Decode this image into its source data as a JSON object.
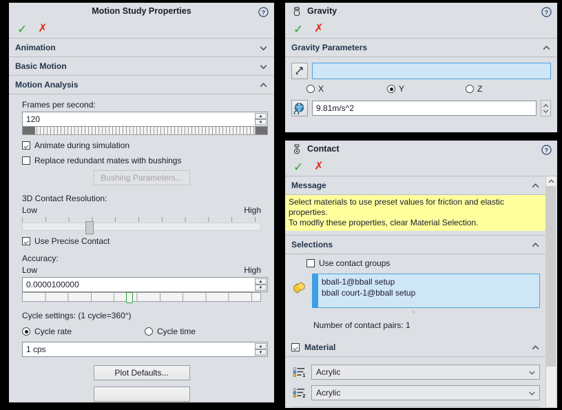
{
  "motion_study": {
    "title": "Motion Study Properties",
    "help_icon": "help-circle-icon",
    "accept_icon": "check-icon",
    "cancel_icon": "x-icon",
    "groups": [
      {
        "label": "Animation",
        "expanded": false
      },
      {
        "label": "Basic Motion",
        "expanded": false
      },
      {
        "label": "Motion Analysis",
        "expanded": true
      }
    ],
    "frames_per_second": {
      "label": "Frames per second:",
      "value": "120"
    },
    "animate_during_simulation": {
      "label": "Animate during simulation",
      "checked": true
    },
    "replace_redundant_mates": {
      "label": "Replace redundant mates with bushings",
      "checked": false
    },
    "bushing_parameters_button": {
      "label": "Bushing Parameters...",
      "enabled": false
    },
    "contact_resolution": {
      "label": "3D Contact Resolution:",
      "low_label": "Low",
      "high_label": "High",
      "position_percent": 28
    },
    "use_precise_contact": {
      "label": "Use Precise Contact",
      "checked": true
    },
    "accuracy": {
      "label": "Accuracy:",
      "low_label": "Low",
      "high_label": "High",
      "value": "0.0000100000",
      "position_percent": 45
    },
    "cycle_settings": {
      "label": "Cycle settings: (1 cycle=360°)",
      "cycle_rate_label": "Cycle rate",
      "cycle_time_label": "Cycle time",
      "selected": "Cycle rate",
      "rate_value": "1 cps"
    },
    "plot_defaults_button": "Plot Defaults..."
  },
  "gravity": {
    "title": "Gravity",
    "title_icon": "gravity-icon",
    "help_icon": "help-circle-icon",
    "accept_icon": "check-icon",
    "cancel_icon": "x-icon",
    "parameters_group": {
      "label": "Gravity Parameters",
      "expanded": true
    },
    "reference_selection": {
      "icon": "select-direction-icon",
      "value": ""
    },
    "axis_options": [
      {
        "label": "X",
        "selected": false
      },
      {
        "label": "Y",
        "selected": true
      },
      {
        "label": "Z",
        "selected": false
      }
    ],
    "magnitude": {
      "icon": "numeric-globe-icon",
      "value": "9.81m/s^2"
    }
  },
  "contact": {
    "title": "Contact",
    "title_icon": "contact-icon",
    "help_icon": "help-circle-icon",
    "accept_icon": "check-icon",
    "cancel_icon": "x-icon",
    "message_group": {
      "label": "Message",
      "expanded": true
    },
    "message_line1": "Select materials to use preset values for friction and elastic properties.",
    "message_line2": "To modfiy these properties, clear Material Selection.",
    "selections_group": {
      "label": "Selections",
      "expanded": true
    },
    "use_contact_groups": {
      "label": "Use contact groups",
      "checked": false
    },
    "selection_icon": "faces-selection-icon",
    "selected_items": [
      "bball-1@bball setup",
      "bball court-1@bball setup"
    ],
    "contact_pairs_text": "Number of contact pairs: 1",
    "material_group": {
      "label": "Material",
      "expanded": true,
      "checked": true
    },
    "material_1": {
      "icon": "material-list-1-icon",
      "value": "Acrylic"
    },
    "material_2": {
      "icon": "material-list-2-icon",
      "value": "Acrylic"
    },
    "scrollbar": {
      "up_icon": "scroll-up-icon",
      "down_icon": "scroll-down-icon"
    }
  },
  "colors": {
    "panel_bg": "#dcdfe3",
    "accept_green": "#2ea02e",
    "cancel_red": "#e02b15",
    "selection_blue": "#cfe6f7",
    "message_yellow": "#ffff9e"
  }
}
